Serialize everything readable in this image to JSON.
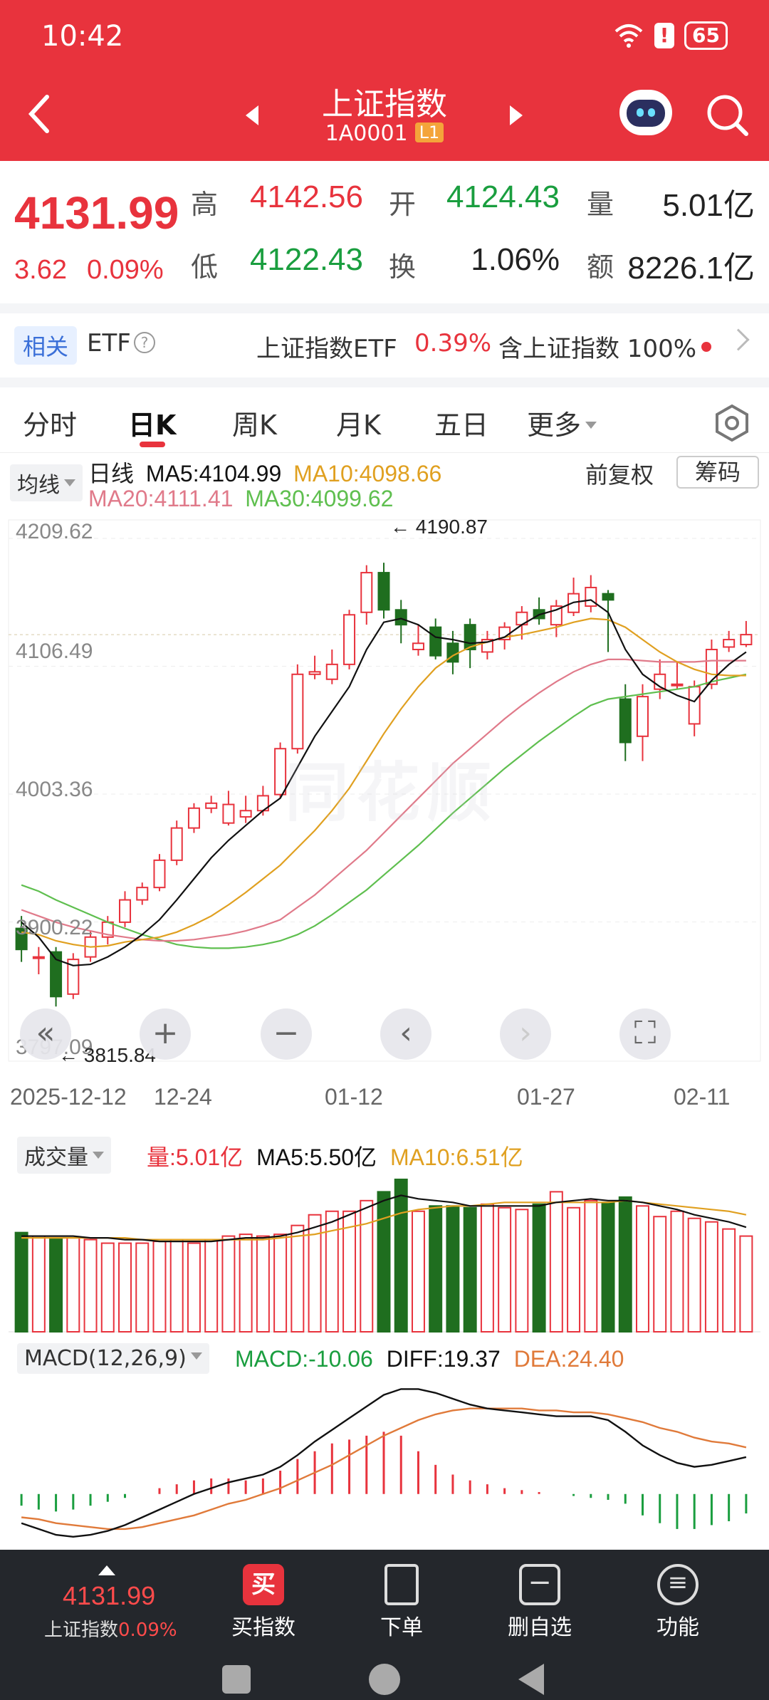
{
  "status": {
    "time": "10:42",
    "battery": "65"
  },
  "header": {
    "title": "上证指数",
    "code": "1A0001",
    "badge": "L1"
  },
  "quote": {
    "price": "4131.99",
    "change": "3.62",
    "change_pct": "0.09%",
    "high_label": "高",
    "high": "4142.56",
    "open_label": "开",
    "open": "4124.43",
    "vol_label": "量",
    "volume": "5.01亿",
    "low_label": "低",
    "low": "4122.43",
    "turn_label": "换",
    "turnover": "1.06%",
    "amt_label": "额",
    "amount": "8226.1亿"
  },
  "etf": {
    "tag": "相关",
    "etf_word": "ETF",
    "help": "?",
    "name": "上证指数ETF",
    "pct": "0.39%",
    "holding": "含上证指数 100%"
  },
  "tabs": [
    "分时",
    "日K",
    "周K",
    "月K",
    "五日",
    "更多"
  ],
  "active_tab": 1,
  "chart_header": {
    "indicator_select": "均线",
    "line_label": "日线",
    "ma5": "MA5:4104.99",
    "ma10": "MA10:4098.66",
    "ma20": "MA20:4111.41",
    "ma30": "MA30:4099.62",
    "adjust": "前复权",
    "chips_button": "筹码"
  },
  "colors": {
    "up": "#e8333d",
    "down": "#1f6e1f",
    "ma5": "#111111",
    "ma10": "#e0a020",
    "ma20": "#e07a8a",
    "ma30": "#5fbf4f",
    "dea": "#e07a3a"
  },
  "chart_data": {
    "type": "candlestick",
    "y_ticks": [
      "4209.62",
      "4106.49",
      "4003.36",
      "3900.22",
      "3797.09"
    ],
    "ylim": [
      3797.09,
      4209.62
    ],
    "x_ticks": [
      "2025-12-12",
      "12-24",
      "01-12",
      "01-27",
      "02-11"
    ],
    "high_annotation": "4190.87",
    "low_annotation": "3815.84",
    "candles": [
      [
        3895,
        3878,
        3905,
        3868
      ],
      [
        3872,
        3872,
        3880,
        3858
      ],
      [
        3876,
        3840,
        3880,
        3832
      ],
      [
        3842,
        3870,
        3875,
        3838
      ],
      [
        3872,
        3888,
        3893,
        3868
      ],
      [
        3888,
        3900,
        3905,
        3882
      ],
      [
        3900,
        3918,
        3925,
        3896
      ],
      [
        3918,
        3928,
        3932,
        3914
      ],
      [
        3928,
        3950,
        3955,
        3925
      ],
      [
        3950,
        3976,
        3982,
        3946
      ],
      [
        3976,
        3992,
        3996,
        3972
      ],
      [
        3992,
        3996,
        4002,
        3988
      ],
      [
        3980,
        3995,
        4006,
        3978
      ],
      [
        3985,
        3990,
        4002,
        3980
      ],
      [
        3990,
        4002,
        4010,
        3986
      ],
      [
        4003,
        4040,
        4045,
        4000
      ],
      [
        4040,
        4100,
        4108,
        4036
      ],
      [
        4100,
        4102,
        4115,
        4096
      ],
      [
        4096,
        4108,
        4120,
        4092
      ],
      [
        4108,
        4148,
        4152,
        4104
      ],
      [
        4150,
        4182,
        4188,
        4140
      ],
      [
        4182,
        4152,
        4190,
        4145
      ],
      [
        4152,
        4140,
        4160,
        4125
      ],
      [
        4120,
        4125,
        4140,
        4115
      ],
      [
        4138,
        4115,
        4145,
        4112
      ],
      [
        4125,
        4110,
        4135,
        4100
      ],
      [
        4140,
        4120,
        4145,
        4105
      ],
      [
        4118,
        4128,
        4135,
        4112
      ],
      [
        4128,
        4138,
        4142,
        4120
      ],
      [
        4140,
        4150,
        4155,
        4128
      ],
      [
        4152,
        4145,
        4162,
        4140
      ],
      [
        4140,
        4155,
        4160,
        4130
      ],
      [
        4150,
        4165,
        4178,
        4147
      ],
      [
        4155,
        4170,
        4180,
        4150
      ],
      [
        4165,
        4160,
        4168,
        4118
      ],
      [
        4080,
        4045,
        4092,
        4030
      ],
      [
        4050,
        4082,
        4092,
        4030
      ],
      [
        4088,
        4100,
        4112,
        4080
      ],
      [
        4092,
        4092,
        4110,
        4088
      ],
      [
        4060,
        4090,
        4095,
        4050
      ],
      [
        4092,
        4120,
        4128,
        4088
      ],
      [
        4122,
        4128,
        4135,
        4118
      ],
      [
        4124,
        4132,
        4143,
        4122
      ]
    ],
    "ma5": [
      3900,
      3888,
      3870,
      3865,
      3866,
      3872,
      3880,
      3890,
      3902,
      3918,
      3935,
      3952,
      3966,
      3978,
      3990,
      4000,
      4025,
      4050,
      4070,
      4090,
      4120,
      4142,
      4145,
      4140,
      4130,
      4128,
      4125,
      4126,
      4130,
      4140,
      4148,
      4152,
      4158,
      4160,
      4150,
      4120,
      4100,
      4090,
      4083,
      4078,
      4095,
      4108,
      4118
    ],
    "ma10": [
      3892,
      3890,
      3885,
      3882,
      3880,
      3881,
      3884,
      3886,
      3888,
      3892,
      3898,
      3905,
      3914,
      3924,
      3935,
      3946,
      3960,
      3974,
      3990,
      4008,
      4030,
      4052,
      4072,
      4090,
      4105,
      4115,
      4122,
      4126,
      4130,
      4132,
      4135,
      4138,
      4142,
      4145,
      4144,
      4138,
      4128,
      4118,
      4110,
      4104,
      4100,
      4099,
      4099
    ],
    "ma20": [
      3910,
      3905,
      3900,
      3896,
      3893,
      3890,
      3888,
      3886,
      3885,
      3885,
      3886,
      3888,
      3890,
      3893,
      3897,
      3902,
      3912,
      3922,
      3934,
      3946,
      3958,
      3972,
      3986,
      4000,
      4014,
      4028,
      4040,
      4052,
      4064,
      4075,
      4085,
      4094,
      4102,
      4108,
      4112,
      4112,
      4111,
      4110,
      4110,
      4110,
      4111,
      4111,
      4111
    ],
    "ma30": [
      3930,
      3925,
      3918,
      3912,
      3906,
      3900,
      3895,
      3890,
      3886,
      3882,
      3880,
      3879,
      3879,
      3880,
      3882,
      3885,
      3890,
      3897,
      3906,
      3916,
      3926,
      3938,
      3950,
      3962,
      3975,
      3988,
      4000,
      4012,
      4024,
      4035,
      4046,
      4056,
      4066,
      4075,
      4080,
      4082,
      4084,
      4086,
      4088,
      4090,
      4094,
      4097,
      4100
    ]
  },
  "volume": {
    "select": "成交量",
    "vol": "量:5.01亿",
    "ma5": "MA5:5.50亿",
    "ma10": "MA10:6.51亿",
    "values": [
      5.6,
      5.4,
      5.3,
      5.3,
      5.2,
      5.0,
      5.0,
      5.0,
      5.1,
      5.2,
      5.0,
      5.2,
      5.4,
      5.5,
      5.4,
      5.5,
      6.0,
      6.6,
      6.8,
      6.8,
      7.4,
      7.9,
      8.6,
      6.8,
      7.1,
      7.1,
      7.0,
      7.2,
      7.0,
      6.9,
      7.2,
      7.9,
      7.0,
      7.4,
      7.3,
      7.6,
      7.1,
      6.5,
      6.8,
      6.4,
      6.2,
      5.8,
      5.4
    ],
    "ma5_line": [
      5.4,
      5.4,
      5.4,
      5.4,
      5.3,
      5.3,
      5.2,
      5.2,
      5.1,
      5.1,
      5.1,
      5.1,
      5.2,
      5.3,
      5.3,
      5.4,
      5.6,
      5.9,
      6.2,
      6.6,
      7.0,
      7.4,
      7.7,
      7.5,
      7.4,
      7.3,
      7.1,
      7.1,
      7.1,
      7.1,
      7.1,
      7.3,
      7.4,
      7.5,
      7.4,
      7.4,
      7.3,
      7.1,
      6.9,
      6.6,
      6.4,
      6.2,
      5.9
    ],
    "ma10_line": [
      5.3,
      5.3,
      5.3,
      5.3,
      5.3,
      5.3,
      5.3,
      5.2,
      5.2,
      5.2,
      5.2,
      5.2,
      5.2,
      5.2,
      5.2,
      5.3,
      5.4,
      5.5,
      5.7,
      5.9,
      6.1,
      6.4,
      6.7,
      6.9,
      7.0,
      7.1,
      7.1,
      7.2,
      7.3,
      7.3,
      7.3,
      7.3,
      7.3,
      7.3,
      7.3,
      7.4,
      7.3,
      7.2,
      7.1,
      7.0,
      6.9,
      6.8,
      6.6
    ]
  },
  "macd": {
    "select": "MACD(12,26,9)",
    "macd": "MACD:-10.06",
    "diff": "DIFF:19.37",
    "dea": "DEA:24.40",
    "hist": [
      -6,
      -8,
      -9,
      -8,
      -6,
      -4,
      -2,
      0,
      3,
      5,
      7,
      8,
      8,
      7,
      8,
      12,
      18,
      22,
      26,
      28,
      30,
      32,
      30,
      22,
      15,
      10,
      7,
      5,
      3,
      2,
      1,
      0,
      -1,
      -2,
      -3,
      -5,
      -11,
      -15,
      -18,
      -18,
      -16,
      -14,
      -10
    ],
    "diff_line": [
      -15,
      -18,
      -21,
      -22,
      -21,
      -19,
      -16,
      -12,
      -8,
      -4,
      0,
      3,
      6,
      8,
      10,
      14,
      20,
      27,
      33,
      39,
      45,
      51,
      54,
      54,
      52,
      49,
      46,
      44,
      43,
      42,
      41,
      40,
      40,
      40,
      38,
      32,
      25,
      20,
      16,
      14,
      15,
      17,
      19
    ],
    "dea_line": [
      -12,
      -13,
      -15,
      -16,
      -17,
      -18,
      -18,
      -17,
      -15,
      -13,
      -11,
      -8,
      -5,
      -3,
      0,
      3,
      7,
      11,
      15,
      20,
      25,
      30,
      34,
      38,
      41,
      43,
      44,
      44,
      44,
      44,
      43,
      43,
      42,
      42,
      41,
      39,
      37,
      34,
      32,
      29,
      27,
      26,
      24
    ]
  },
  "bottom_bar": {
    "price": "4131.99",
    "name": "上证指数",
    "pct": "0.09%",
    "buy_icon": "买",
    "buy": "买指数",
    "order": "下单",
    "remove": "删自选",
    "func": "功能"
  }
}
